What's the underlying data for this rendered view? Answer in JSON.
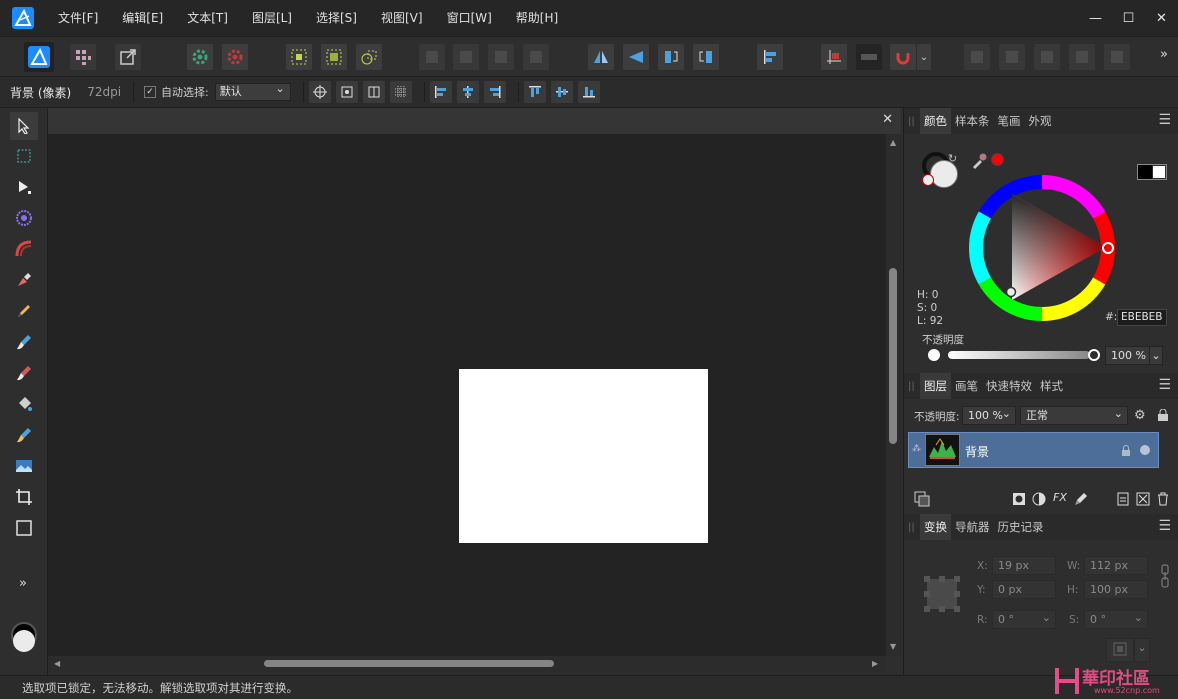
{
  "menu": {
    "items": [
      "文件[F]",
      "编辑[E]",
      "文本[T]",
      "图层[L]",
      "选择[S]",
      "视图[V]",
      "窗口[W]",
      "帮助[H]"
    ],
    "window_controls": [
      "—",
      "☐",
      "✕"
    ]
  },
  "context": {
    "layer_label": "背景 (像素)",
    "dpi": "72dpi",
    "auto_select_checkmark": "✓",
    "auto_select_label": "自动选择:",
    "auto_select_value": "默认"
  },
  "document": {
    "close_glyph": "✕",
    "page_color": "#ffffff"
  },
  "color_panel": {
    "tabs": [
      "颜色",
      "样本条",
      "笔画",
      "外观"
    ],
    "h": "H: 0",
    "s": "S: 0",
    "l": "L: 92",
    "hex_label": "#:",
    "hex_value": "EBEBEB",
    "opacity_label": "不透明度",
    "opacity_value": "100 %",
    "fill_color": "#ebebeb",
    "eyedropper_color": "#ff0000"
  },
  "layers_panel": {
    "tabs": [
      "图层",
      "画笔",
      "快速特效",
      "样式"
    ],
    "opacity_label": "不透明度:",
    "opacity_value": "100 %",
    "blend_mode": "正常",
    "layer_name": "背景",
    "fx_label": "FX"
  },
  "transform_panel": {
    "tabs": [
      "变换",
      "导航器",
      "历史记录"
    ],
    "x_label": "X:",
    "x_value": "19 px",
    "y_label": "Y:",
    "y_value": "0 px",
    "w_label": "W:",
    "w_value": "112 px",
    "h_label": "H:",
    "h_value": "100 px",
    "r_label": "R:",
    "r_value": "0 °",
    "s_label": "S:",
    "s_value": "0 °"
  },
  "tools": {
    "more_glyph": "»"
  },
  "toolbar": {
    "more_glyph": "»"
  },
  "status": {
    "message": "选取项已锁定，无法移动。解锁选取项对其进行变换。"
  },
  "watermark": {
    "text": "華印社區",
    "url": "www.52cnp.com"
  },
  "colors": {
    "accent": "#4e6e9a",
    "brand_blue": "#1e90ff"
  }
}
